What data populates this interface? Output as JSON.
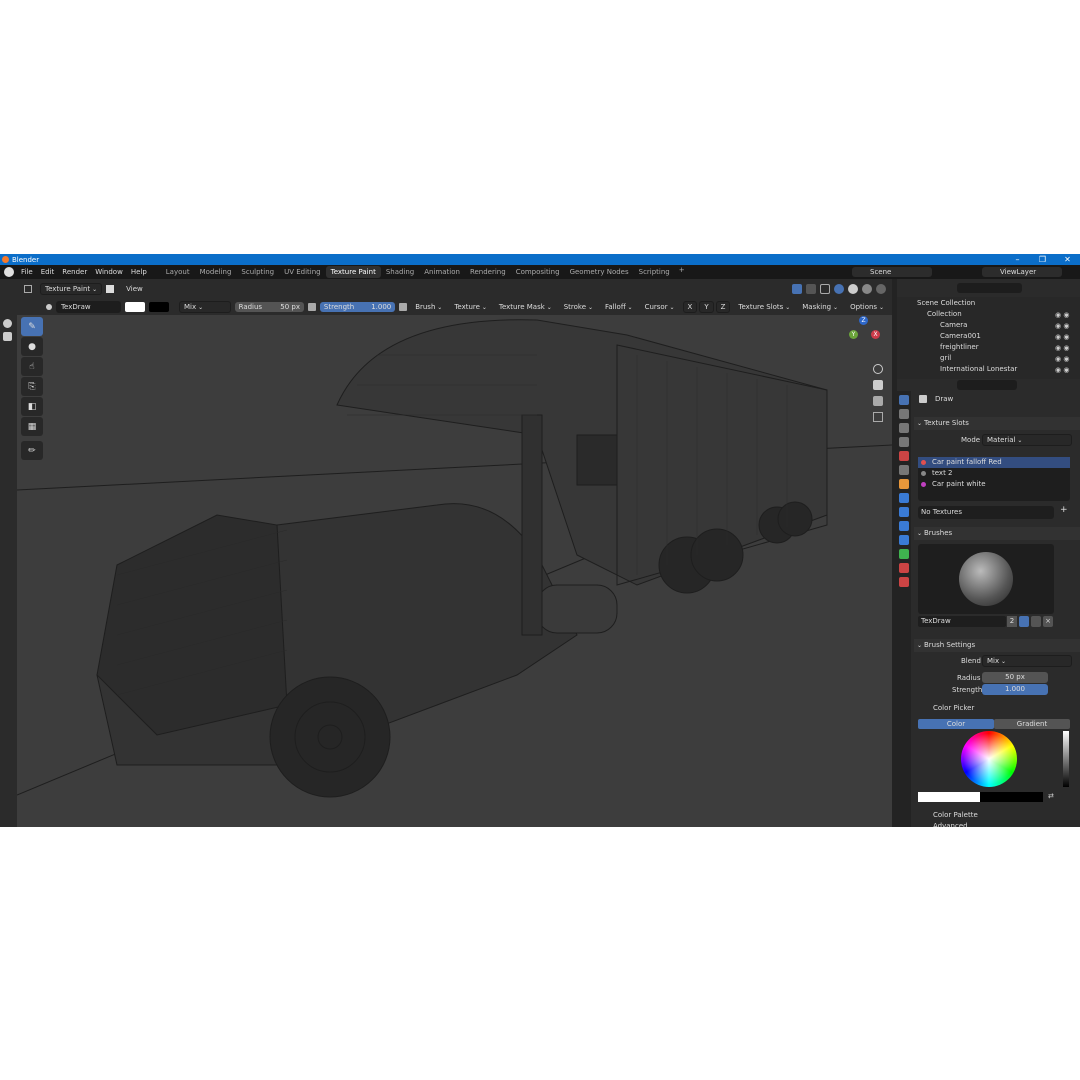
{
  "window": {
    "title": "Blender",
    "controls": [
      "–",
      "❐",
      "✕"
    ]
  },
  "menu": {
    "items": [
      "File",
      "Edit",
      "Render",
      "Window",
      "Help"
    ]
  },
  "workspaces": [
    "Layout",
    "Modeling",
    "Sculpting",
    "UV Editing",
    "Texture Paint",
    "Shading",
    "Animation",
    "Rendering",
    "Compositing",
    "Geometry Nodes",
    "Scripting"
  ],
  "active_workspace": "Texture Paint",
  "scene": {
    "name": "Scene",
    "view_layer": "ViewLayer"
  },
  "viewport_header": {
    "mode": "Texture Paint",
    "view": "View"
  },
  "tool_header": {
    "brush_name": "TexDraw",
    "blend": "Mix",
    "radius_label": "Radius",
    "radius_value": "50 px",
    "strength_label": "Strength",
    "strength_value": "1.000",
    "menus": [
      "Brush",
      "Texture",
      "Texture Mask",
      "Stroke",
      "Falloff",
      "Cursor"
    ],
    "axes": [
      "X",
      "Y",
      "Z"
    ],
    "right_menus": [
      "Texture Slots",
      "Masking",
      "Options"
    ]
  },
  "gizmo": {
    "x": "X",
    "y": "Y",
    "z": "Z"
  },
  "outliner": {
    "root": "Scene Collection",
    "collection": "Collection",
    "objects": [
      "Camera",
      "Camera001",
      "freightliner",
      "gril",
      "International Lonestar"
    ]
  },
  "properties": {
    "tool_name": "Draw",
    "texture_slots": {
      "header": "Texture Slots",
      "mode_label": "Mode",
      "mode_value": "Material",
      "slots": [
        {
          "name": "Car paint falloff Red",
          "color": "#e05050"
        },
        {
          "name": "text 2",
          "color": "#888888"
        },
        {
          "name": "Car paint white",
          "color": "#c040c0"
        }
      ],
      "no_textures": "No Textures"
    },
    "brushes": {
      "header": "Brushes",
      "name": "TexDraw",
      "users": "2"
    },
    "brush_settings": {
      "header": "Brush Settings",
      "blend_label": "Blend",
      "blend_value": "Mix",
      "radius_label": "Radius",
      "radius_value": "50 px",
      "strength_label": "Strength",
      "strength_value": "1.000"
    },
    "color_picker": {
      "header": "Color Picker",
      "tabs": [
        "Color",
        "Gradient"
      ],
      "active_tab": "Color"
    },
    "color_palette": "Color Palette",
    "advanced": "Advanced"
  },
  "colors": {
    "accent": "#4772b3",
    "titlebar": "#0b6ec9",
    "panel": "#2b2b2b",
    "viewport": "#3d3d3d"
  }
}
